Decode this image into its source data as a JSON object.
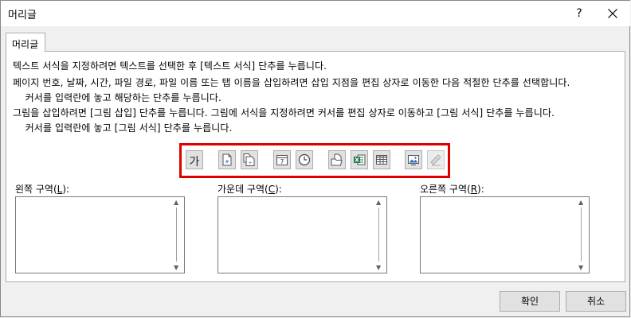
{
  "window": {
    "title": "머리글",
    "help": "?"
  },
  "tab": {
    "label": "머리글"
  },
  "instructions": [
    "텍스트 서식을 지정하려면 텍스트를 선택한 후 [텍스트 서식] 단추를 누릅니다.",
    "페이지 번호, 날짜, 시간, 파일 경로, 파일 이름 또는 탭 이름을 삽입하려면 삽입 지점을 편집 상자로 이동한 다음 적절한 단추를 선택합니다.",
    "    커서를 입력란에 놓고 해당하는 단추를 누릅니다.",
    "그림을 삽입하려면 [그림 삽입] 단추를 누릅니다.  그림에 서식을 지정하려면 커서를 편집 상자로 이동하고 [그림 서식] 단추를 누릅니다.",
    "    커서를 입력란에 놓고 [그림 서식] 단추를 누릅니다."
  ],
  "toolbar": {
    "format_text_glyph": "가",
    "page_number_glyph": "#",
    "number_of_pages_glyph": "+",
    "date_glyph": "7",
    "buttons": [
      "format-text",
      "page-number",
      "number-of-pages",
      "date",
      "time",
      "file-path",
      "file-name",
      "sheet-name",
      "insert-picture",
      "format-picture"
    ],
    "disabled": [
      "format-picture"
    ],
    "highlight_color": "#e00000"
  },
  "sections": {
    "left": {
      "label": "왼쪽 구역(",
      "key": "L",
      "suffix": "):",
      "value": ""
    },
    "center": {
      "label": "가운데 구역(",
      "key": "C",
      "suffix": "):",
      "value": ""
    },
    "right": {
      "label": "오른쪽 구역(",
      "key": "R",
      "suffix": "):",
      "value": ""
    }
  },
  "buttons": {
    "ok": "확인",
    "cancel": "취소"
  }
}
